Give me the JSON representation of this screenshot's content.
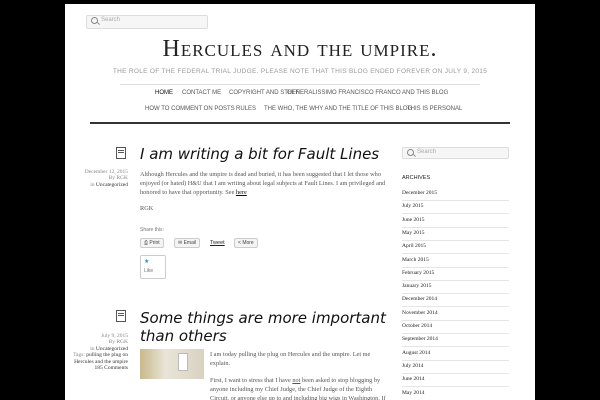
{
  "header": {
    "search_placeholder": "Search",
    "site_title": "Hercules and the umpire.",
    "tagline": "The role of the federal trial judge. Please note that this blog ended forever on July 9, 2015"
  },
  "nav": [
    "Home",
    "Contact Me",
    "Copyright and Stuff",
    "Generalissimo Francisco Franco and this Blog",
    "How to Comment on Posts",
    "Rules",
    "The Who, the Why and the Title of this Blog",
    "This is personal"
  ],
  "posts": [
    {
      "date": "December 12, 2015",
      "by": "By RGK",
      "in_label": "in",
      "category": "Uncategorized",
      "title": "I am writing a bit for Fault Lines",
      "body": "Although Hercules and the umpire is dead and buried, it has been suggested that I let those who enjoyed (or hated) H&U that I am writing about legal subjects at Fault Lines.   I am privileged and honored to have that opportunity.  See ",
      "link": "here",
      "signature": "RGK",
      "share_label": "Share this:",
      "share": {
        "print": "Print",
        "email": "Email",
        "tweet": "Tweet",
        "more": "More"
      },
      "like": "Like"
    },
    {
      "date": "July 9, 2015",
      "by": "By RGK",
      "in_label": "in",
      "category": "Uncategorized",
      "tags_label": "Tags:",
      "tags": "pulling the plug on Hercules and the umpire",
      "comments": "185 Comments",
      "title": "Some things are more important than others",
      "para1": "I am today pulling the plug on Hercules and the umpire.  Let me explain.",
      "para2_a": "First, I want to stress that I have ",
      "para2_not": "not",
      "para2_b": " been asked to stop blogging by anyone including my Chief Judge, the Chief Judge of the Eighth Circuit, or anyone else up to and including big wigs in Washington.  If anything, I have continually received encouragement to"
    }
  ],
  "sidebar": {
    "search_placeholder": "Search",
    "archives_title": "Archives",
    "archives": [
      "December 2015",
      "July 2015",
      "June 2015",
      "May 2015",
      "April 2015",
      "March 2015",
      "February 2015",
      "January 2015",
      "December 2014",
      "November 2014",
      "October 2014",
      "September 2014",
      "August 2014",
      "July 2014",
      "June 2014",
      "May 2014"
    ]
  }
}
